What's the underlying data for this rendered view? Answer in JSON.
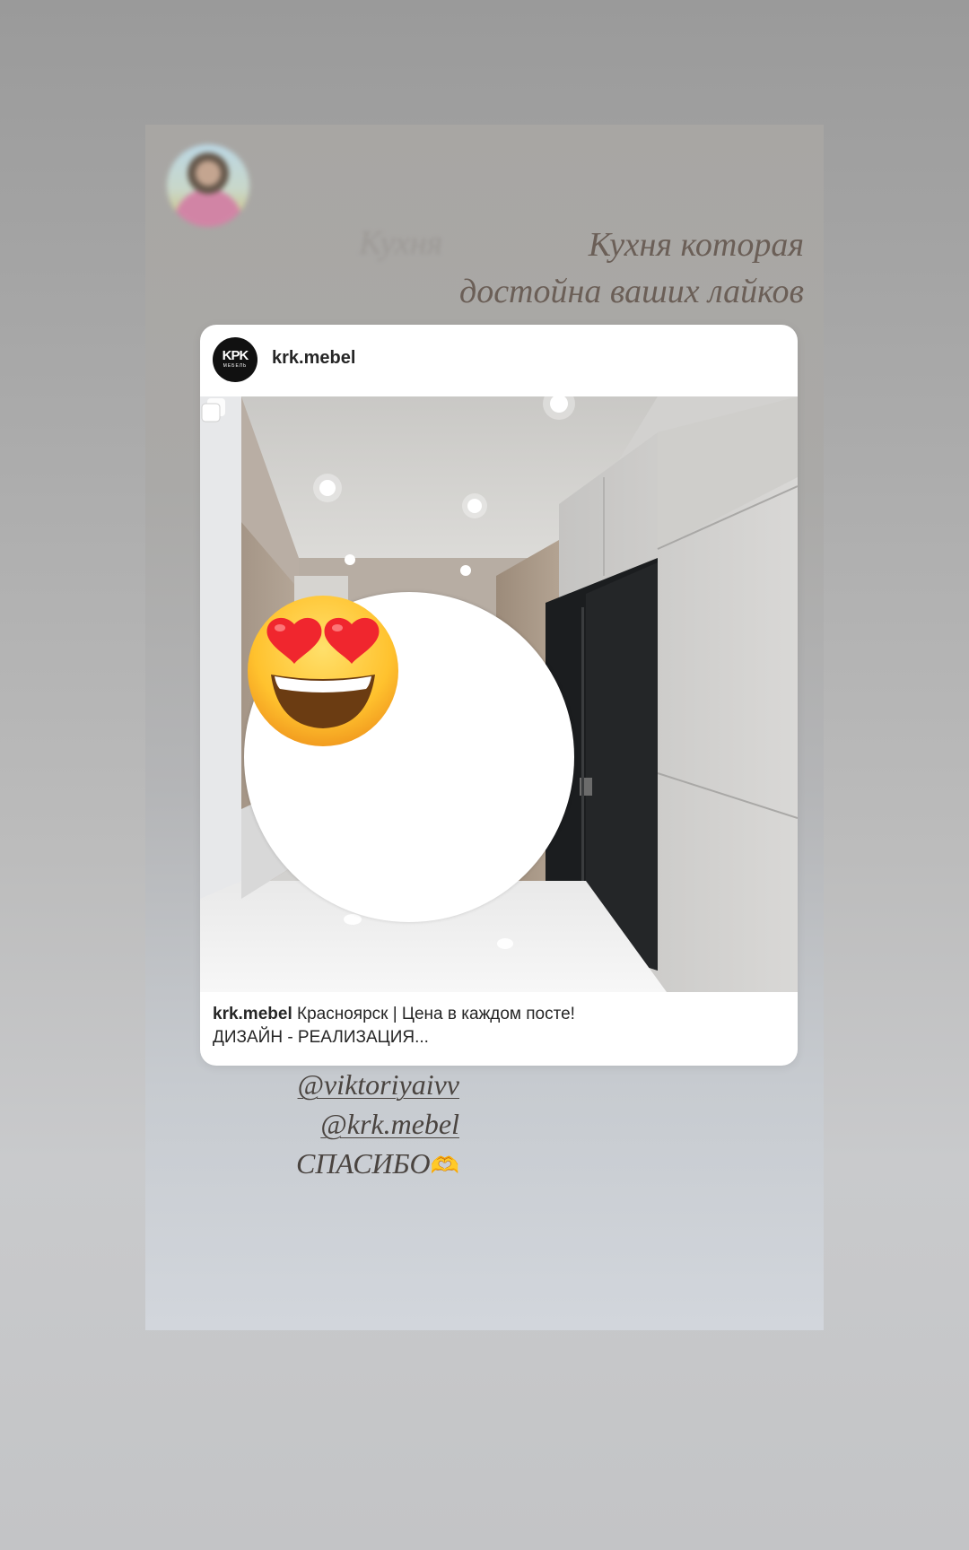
{
  "story": {
    "headline_line1": "Кухня которая",
    "headline_line2": "достойна ваших лайков",
    "headline_ghost": "Кухня"
  },
  "post": {
    "brand_logo_line1": "KPK",
    "brand_logo_line2": "МЕБЕЛЬ",
    "username": "krk.mebel",
    "caption_username": "krk.mebel",
    "caption_line1": " Красноярск | Цена в каждом посте!",
    "caption_line2": "ДИЗАЙН - РЕАЛИЗАЦИЯ...",
    "multi_photo_icon": "carousel-icon"
  },
  "sticker": {
    "emoji": "heart-eyes-emoji"
  },
  "mentions": {
    "mention1": "@viktoriyaivv",
    "mention2": "@krk.mebel",
    "thanks": "СПАСИБО",
    "thanks_emoji": "🫶"
  }
}
